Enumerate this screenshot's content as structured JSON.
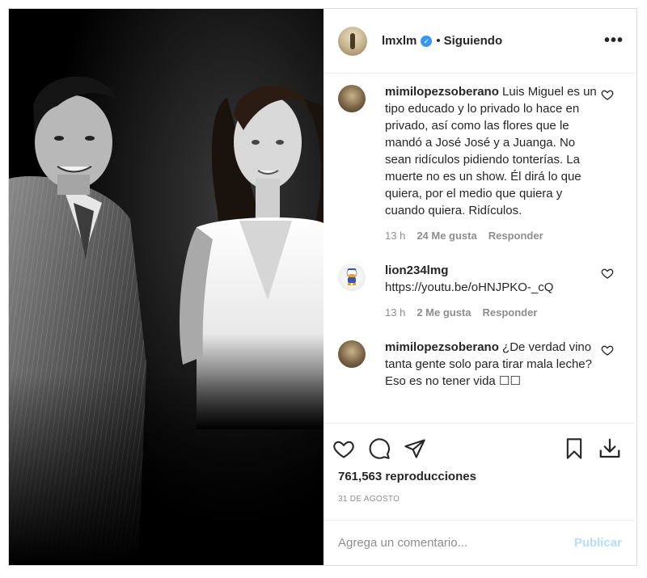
{
  "post": {
    "username": "lmxlm",
    "separator": "•",
    "follow_status": "Siguiendo",
    "more_label": "•••",
    "verified_glyph": "✓"
  },
  "comments": [
    {
      "username": "mimilopezsoberano",
      "text": "Luis Miguel es un tipo educado y lo privado lo hace en privado, así como las flores que le mandó a José José y a Juanga. No sean ridículos pidiendo tonterías. La muerte no es un show. Él dirá lo que quiera, por el medio que quiera y cuando quiera. Ridículos.",
      "time": "13 h",
      "likes": "24 Me gusta",
      "reply": "Responder"
    },
    {
      "username": "lion234lmg",
      "text": "https://youtu.be/oHNJPKO-_cQ",
      "time": "13 h",
      "likes": "2 Me gusta",
      "reply": "Responder"
    },
    {
      "username": "mimilopezsoberano",
      "text": "¿De verdad vino tanta gente solo para tirar mala leche? Eso es no tener vida ☐☐"
    }
  ],
  "actions": {
    "icons": [
      "heart-icon",
      "comment-icon",
      "share-icon",
      "bookmark-icon",
      "download-icon"
    ]
  },
  "stats": {
    "views": "761,563 reproducciones",
    "date": "31 DE AGOSTO"
  },
  "add_comment": {
    "placeholder": "Agrega un comentario...",
    "publish": "Publicar"
  },
  "colors": {
    "verified": "#3897f0",
    "publish_disabled": "#b2dffc",
    "meta_text": "#8e8e8e"
  }
}
